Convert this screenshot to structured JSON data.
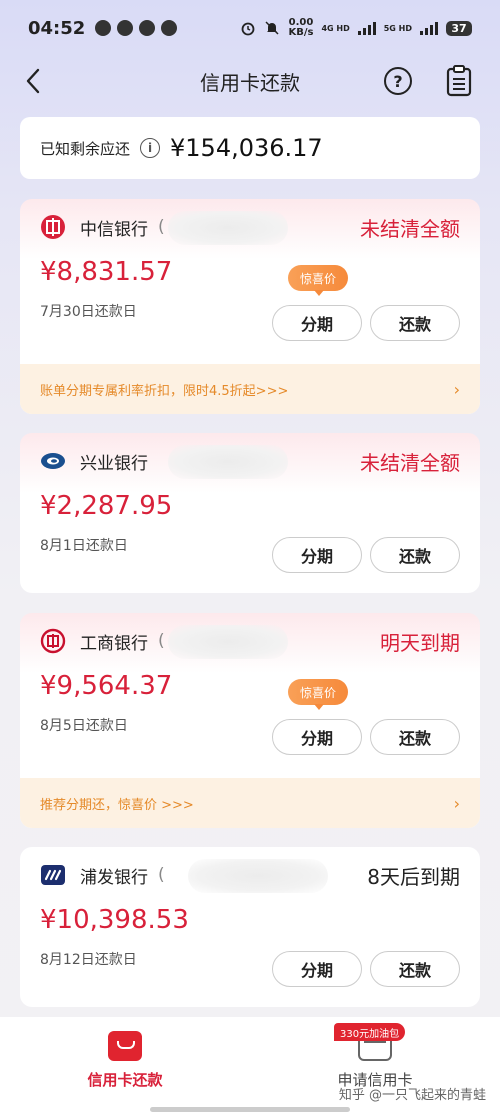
{
  "status_bar": {
    "time": "04:52",
    "net_speed_value": "0.00",
    "net_speed_unit": "KB/s",
    "network_1": "4G HD",
    "network_2": "5G HD",
    "battery": "37"
  },
  "nav": {
    "title": "信用卡还款",
    "back_icon": "chevron-left-icon",
    "help_icon": "question-circle-icon",
    "list_icon": "clipboard-icon"
  },
  "summary": {
    "label": "已知剩余应还",
    "amount": "¥154,036.17"
  },
  "cards": [
    {
      "bank": "中信银行",
      "mask": "(",
      "status": "未结清全额",
      "amount": "¥8,831.57",
      "due": "7月30日还款日",
      "tag": "惊喜价",
      "installment_label": "分期",
      "repay_label": "还款",
      "promo": "账单分期专属利率折扣，限时4.5折起>>>"
    },
    {
      "bank": "兴业银行",
      "mask": "",
      "status": "未结清全额",
      "amount": "¥2,287.95",
      "due": "8月1日还款日",
      "installment_label": "分期",
      "repay_label": "还款"
    },
    {
      "bank": "工商银行",
      "mask": "(",
      "status": "明天到期",
      "amount": "¥9,564.37",
      "due": "8月5日还款日",
      "tag": "惊喜价",
      "installment_label": "分期",
      "repay_label": "还款",
      "promo": "推荐分期还，惊喜价 >>>"
    },
    {
      "bank": "浦发银行",
      "mask": "(",
      "status": "8天后到期",
      "amount": "¥10,398.53",
      "due": "8月12日还款日",
      "installment_label": "分期",
      "repay_label": "还款"
    }
  ],
  "tabs": {
    "repay_label": "信用卡还款",
    "apply_label": "申请信用卡",
    "apply_badge": "330元加油包"
  },
  "watermark": "知乎 @一只飞起来的青蛙",
  "colors": {
    "accent": "#d8213a",
    "promo": "#e58a2a",
    "tag": "#f68a3b"
  }
}
